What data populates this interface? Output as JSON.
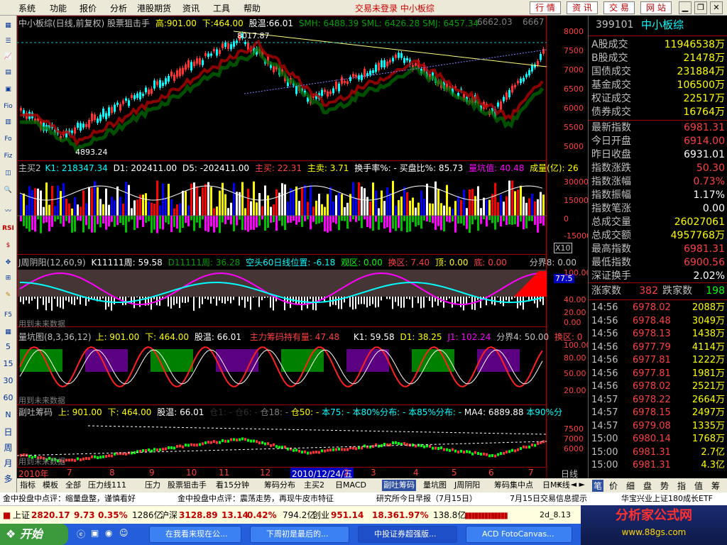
{
  "menu": {
    "items": [
      "系统",
      "功能",
      "报价",
      "分析",
      "港股期货",
      "资讯",
      "工具",
      "帮助"
    ],
    "status": "交易未登录  中小板综",
    "top_buttons": [
      "行 情",
      "资 讯",
      "交 易",
      "网 站"
    ]
  },
  "left_toolbar": {
    "labels": [
      "Fio",
      "Fo",
      "Fiz",
      "RSI",
      "F5"
    ],
    "period_numbers": [
      "5",
      "15",
      "30",
      "60"
    ],
    "period_chars": [
      "N",
      "日",
      "周",
      "月",
      "多"
    ]
  },
  "panel_main": {
    "title": "中小板综(日线,前复权) 股票狙击手",
    "high_label": "高:",
    "high_value": "901.00",
    "low_label": "下:",
    "low_value": "464.00",
    "gain_label": "股温:",
    "gain_value": "66.01",
    "smh": "SMH: 6488.39",
    "sml": "SML: 6426.28",
    "smj": "SMJ: 6457.34",
    "extra1": "6662.03",
    "extra2": "6667",
    "peak_label": "8017.87",
    "trough_label": "4893.24",
    "axis": [
      "8000",
      "7500",
      "7000",
      "6500",
      "6000",
      "5500",
      "5000"
    ]
  },
  "panel_vol": {
    "title": "主买2",
    "k1": "K1: 218347.34",
    "d1": "D1: 202411.00",
    "d5": "D5: -202411.00",
    "zhumai": "主买: 22.31",
    "zhumai2": "主卖: 3.71",
    "huanshou": "换手率%: - 买盘比%: 85.73",
    "liangkeng": "量坑值: 40.48",
    "chengjiao": "成量(亿): 26",
    "axis": [
      "30000",
      "15000",
      "0",
      "-15000"
    ],
    "x10": "X10"
  },
  "panel_zhou": {
    "title": "J周阴阳(12,60,9)",
    "k11111": "K11111周: 59.58",
    "d11111": "D11111周: 36.28",
    "kong60": "空头60日线位置: -6.18",
    "guan": "观区: 0.00",
    "huan": "换区: 7.40",
    "ding": "顶: 0.00",
    "di": "底: 0.00",
    "fenjie": "分界8: 0.00",
    "marker": "77.5",
    "axis": [
      "100.00",
      "40.00",
      "20.00",
      "0.00"
    ],
    "footer": "用到未来数据"
  },
  "panel_lk": {
    "title": "量坑图(8,3,36,12)",
    "high": "上: 901.00",
    "low": "下: 464.00",
    "gain": "股温: 66.01",
    "zhuli": "主力筹码持有量: 47.48",
    "k1": "K1: 59.58",
    "d1": "D1: 38.25",
    "j1": "J1: 102.24",
    "fenjie": "分界4: 50.00",
    "huan": "换区: 0",
    "axis": [
      "100.00",
      "80.00",
      "50.00",
      "20.00"
    ],
    "footer": "用到未来数据"
  },
  "panel_tt": {
    "title": "副吐筹码",
    "high": "上: 901.00",
    "low": "下: 464.00",
    "gain": "股温: 66.01",
    "c1": "仓1: -",
    "c6": "仓6: -",
    "c18": "仓18: -",
    "c50": "仓50: -",
    "b75": "本75: -",
    "b80": "本80%分布: -",
    "b85": "本85%分布: -",
    "ma4": "MA4: 6889.88",
    "b90": "本90%分",
    "axis": [
      "7500",
      "7000",
      "6000"
    ],
    "footer": "用到未来数据"
  },
  "xaxis": {
    "labels": [
      "2010年",
      "7",
      "8",
      "9",
      "10",
      "11",
      "12",
      "2",
      "3",
      "4",
      "5",
      "6",
      "7"
    ],
    "cursor_date": "2010/12/24/五",
    "period": "日线"
  },
  "right_panel": {
    "code": "399101",
    "name": "中小板综",
    "rows1": [
      {
        "k": "A股成交",
        "v": "11946538万"
      },
      {
        "k": "B股成交",
        "v": "21478万"
      },
      {
        "k": "国债成交",
        "v": "231884万"
      },
      {
        "k": "基金成交",
        "v": "106500万"
      },
      {
        "k": "权证成交",
        "v": "22517万"
      },
      {
        "k": "债券成交",
        "v": "16764万"
      }
    ],
    "rows2": [
      {
        "k": "最新指数",
        "v": "6981.31",
        "c": "#ff4040"
      },
      {
        "k": "今日开盘",
        "v": "6914.00",
        "c": "#ff4040"
      },
      {
        "k": "昨日收盘",
        "v": "6931.01",
        "c": "#ffffff"
      },
      {
        "k": "指数涨跌",
        "v": "50.30",
        "c": "#ff4040"
      },
      {
        "k": "指数涨幅",
        "v": "0.73%",
        "c": "#ff4040"
      },
      {
        "k": "指数振幅",
        "v": "1.17%",
        "c": "#ffffff"
      },
      {
        "k": "指数笔涨",
        "v": "0.00",
        "c": "#ffffff"
      },
      {
        "k": "总成交量",
        "v": "26027061",
        "c": "#ffff00"
      },
      {
        "k": "总成交额",
        "v": "4957768万",
        "c": "#ffff00"
      },
      {
        "k": "最高指数",
        "v": "6981.31",
        "c": "#ff4040"
      },
      {
        "k": "最低指数",
        "v": "6900.56",
        "c": "#ff4040"
      },
      {
        "k": "深证换手",
        "v": "2.02%",
        "c": "#ffffff"
      }
    ],
    "zhang_label": "涨家数",
    "zhang_value": "382",
    "die_label": "跌家数",
    "die_value": "198",
    "ticks": [
      {
        "t": "14:56",
        "p": "6978.02",
        "v": "2088万"
      },
      {
        "t": "14:56",
        "p": "6978.48",
        "v": "3049万"
      },
      {
        "t": "14:56",
        "p": "6978.13",
        "v": "1438万"
      },
      {
        "t": "14:56",
        "p": "6977.79",
        "v": "4114万"
      },
      {
        "t": "14:56",
        "p": "6977.81",
        "v": "1222万"
      },
      {
        "t": "14:56",
        "p": "6977.81",
        "v": "1981万"
      },
      {
        "t": "14:56",
        "p": "6978.02",
        "v": "2521万"
      },
      {
        "t": "14:57",
        "p": "6978.22",
        "v": "2664万"
      },
      {
        "t": "14:57",
        "p": "6978.15",
        "v": "2497万"
      },
      {
        "t": "14:57",
        "p": "6979.08",
        "v": "1335万"
      },
      {
        "t": "15:00",
        "p": "6980.14",
        "v": "1768万"
      },
      {
        "t": "15:00",
        "p": "6981.31",
        "v": "2.7亿"
      },
      {
        "t": "15:00",
        "p": "6981.31",
        "v": "4.3亿"
      }
    ]
  },
  "bottom_tabs": [
    "指标",
    "模板",
    "全部",
    "压力线111",
    "压力",
    "股票狙击手",
    "看15分钟",
    "筹码分布",
    "主买2",
    "日MACD",
    "副吐筹码",
    "量坑图",
    "J周阴阳",
    "筹码集中点",
    "日MK线"
  ],
  "right_tabs": [
    "笔",
    "价",
    "细",
    "盘",
    "势",
    "指",
    "值",
    "筹"
  ],
  "ticker": [
    "金中投盘中点评：缩量盘整，谨慎看好",
    "金中投盘中点评：震荡走势，再现牛皮市特征",
    "研究所今日早报（7月15日）",
    "7月15日交易信息提示",
    "华宝兴业上证180成长ETF"
  ],
  "index_bar": {
    "sh_label": "上证",
    "sh_value": "2820.17",
    "sh_chg": "9.73",
    "sh_pct": "0.35%",
    "sh_amt": "1286亿",
    "sz_label": "沪深",
    "sz_value": "3128.89",
    "sz_chg": "13.14",
    "sz_pct": "0.42%",
    "sz_amt": "794.2亿",
    "cy_label": "创业",
    "cy_value": "951.14",
    "cy_chg": "18.36",
    "cy_pct": "1.97%",
    "cy_amt": "138.8亿",
    "misc": "2d_8.13"
  },
  "taskbar": {
    "start": "开始",
    "items": [
      "在我看来现在公...",
      "下周初是最后的...",
      "中投证券超强版...",
      "ACD FotoCanvas..."
    ]
  },
  "watermark": {
    "title": "分析家公式网",
    "url": "www.88gs.com"
  }
}
